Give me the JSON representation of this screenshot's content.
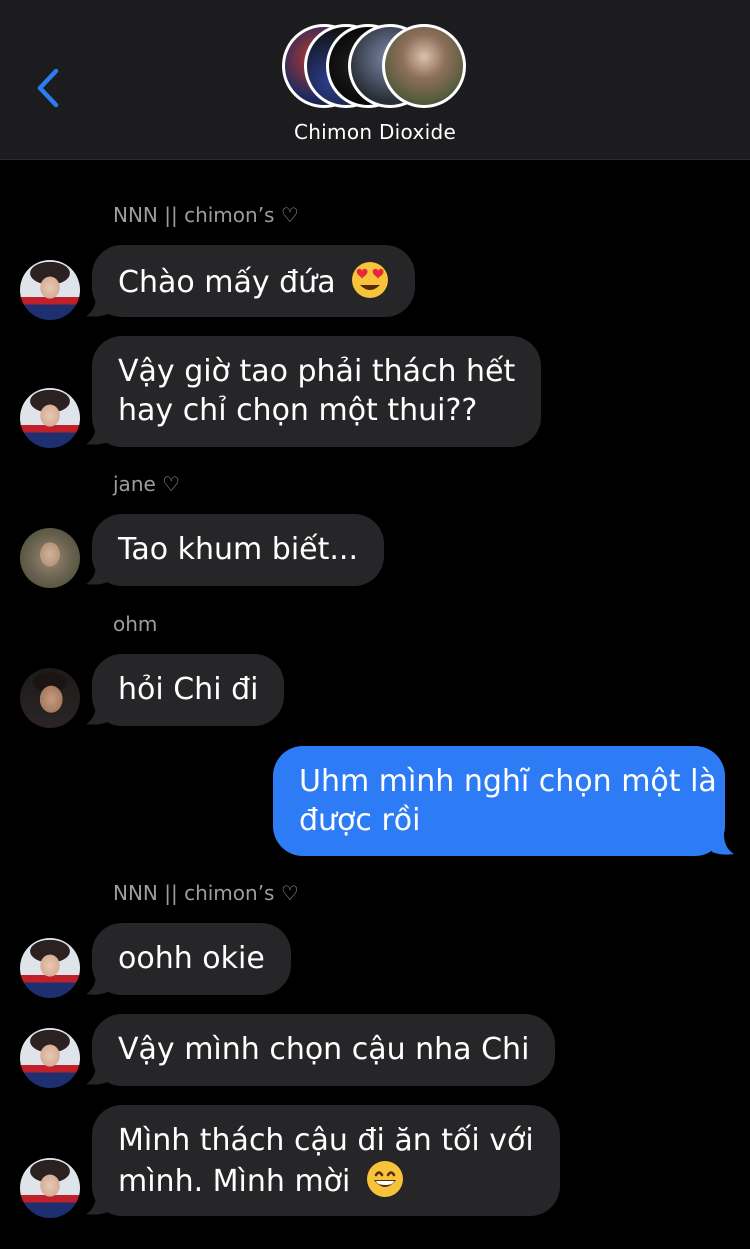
{
  "header": {
    "title": "Chimon Dioxide"
  },
  "messages": [
    {
      "sender": "NNN || chimon’s ♡",
      "text": "Chào mấy đứa",
      "emoji": "heart-eyes-emoji"
    },
    {
      "text_line1": "Vậy giờ tao phải thách hết",
      "text_line2": "hay chỉ chọn một thui??"
    },
    {
      "sender": "jane ♡",
      "text": "Tao khum biết..."
    },
    {
      "sender": "ohm",
      "text": "hỏi Chi đi"
    },
    {
      "outgoing": true,
      "text_line1": "Uhm mình nghĩ chọn một là",
      "text_line2": "được rồi"
    },
    {
      "sender": "NNN || chimon’s ♡",
      "text": "oohh okie"
    },
    {
      "text": "Vậy mình chọn cậu nha Chi"
    },
    {
      "text_line1": "Mình thách cậu đi ăn tối với",
      "text_line2": "mình. Mình mời",
      "emoji": "grinning-emoji"
    }
  ],
  "colors": {
    "header_bg": "#1c1c1e",
    "incoming_bubble": "#262628",
    "outgoing_bubble": "#2d7cf6",
    "accent": "#2d7cf6",
    "sender_label": "#9c9ca1"
  },
  "icons": [
    "back-chevron-icon",
    "heart-eyes-emoji",
    "grinning-emoji"
  ]
}
